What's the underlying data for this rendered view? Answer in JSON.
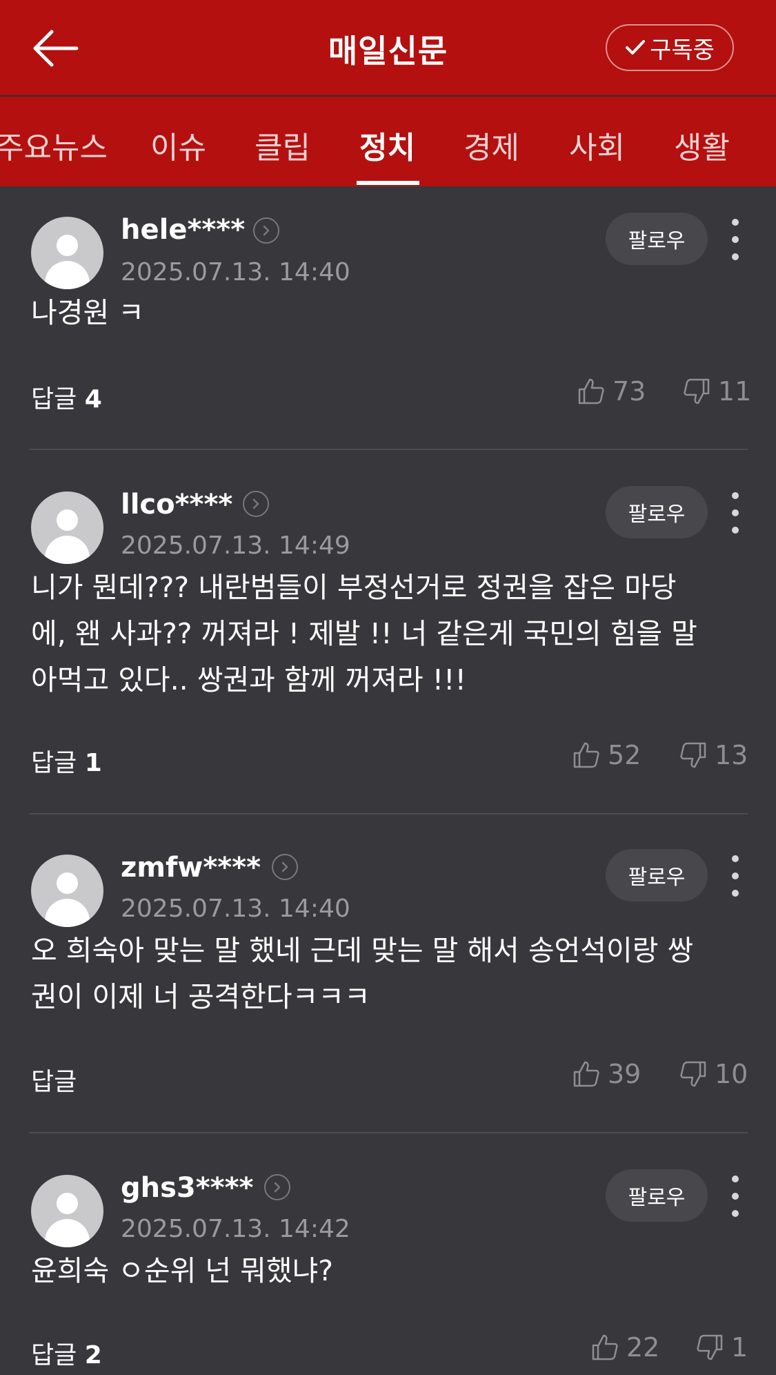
{
  "header": {
    "title": "매일신문",
    "subscribe_label": "구독중"
  },
  "tabs": [
    "주요뉴스",
    "이슈",
    "클립",
    "정치",
    "경제",
    "사회",
    "생활"
  ],
  "active_tab": "정치",
  "follow_label": "팔로우",
  "reply_label": "답글",
  "comments": [
    {
      "username": "hele****",
      "timestamp": "2025.07.13. 14:40",
      "text": "나경원 ㅋ",
      "reply_count": "4",
      "likes": "73",
      "dislikes": "11"
    },
    {
      "username": "llco****",
      "timestamp": "2025.07.13. 14:49",
      "text": "니가 뭔데??? 내란범들이 부정선거로 정권을 잡은 마당에, 왠 사과?? 꺼져라 ! 제발 !! 너 같은게 국민의 힘을 말아먹고 있다.. 쌍권과 함께 꺼져라 !!!",
      "reply_count": "1",
      "likes": "52",
      "dislikes": "13"
    },
    {
      "username": "zmfw****",
      "timestamp": "2025.07.13. 14:40",
      "text": "오 희숙아 맞는 말 했네 근데 맞는 말 해서 송언석이랑 쌍권이 이제 너 공격한다ㅋㅋㅋ",
      "reply_count": "",
      "likes": "39",
      "dislikes": "10"
    },
    {
      "username": "ghs3****",
      "timestamp": "2025.07.13. 14:42",
      "text": "윤희숙 ㅇ순위 넌 뭐했냐?",
      "reply_count": "2",
      "likes": "22",
      "dislikes": "1"
    }
  ],
  "colors": {
    "brand_red": "#b3100f",
    "background": "#38383c",
    "follow_button": "#48484c",
    "muted_text": "#9a9a9f"
  }
}
